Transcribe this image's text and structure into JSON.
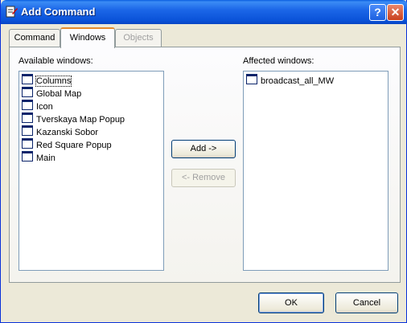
{
  "window": {
    "title": "Add Command"
  },
  "tabs": [
    {
      "label": "Command"
    },
    {
      "label": "Windows"
    },
    {
      "label": "Objects"
    }
  ],
  "available": {
    "label": "Available windows:",
    "items": [
      "Columns",
      "Global Map",
      "Icon",
      "Tverskaya Map Popup",
      "Kazanski Sobor",
      "Red Square Popup",
      "Main"
    ]
  },
  "affected": {
    "label": "Affected windows:",
    "items": [
      "broadcast_all_MW"
    ]
  },
  "buttons": {
    "add": "Add ->",
    "remove": "<- Remove",
    "ok": "OK",
    "cancel": "Cancel"
  },
  "icons": {
    "title": "command-icon",
    "help": "help-icon",
    "close": "close-icon",
    "list_item": "window-icon"
  }
}
